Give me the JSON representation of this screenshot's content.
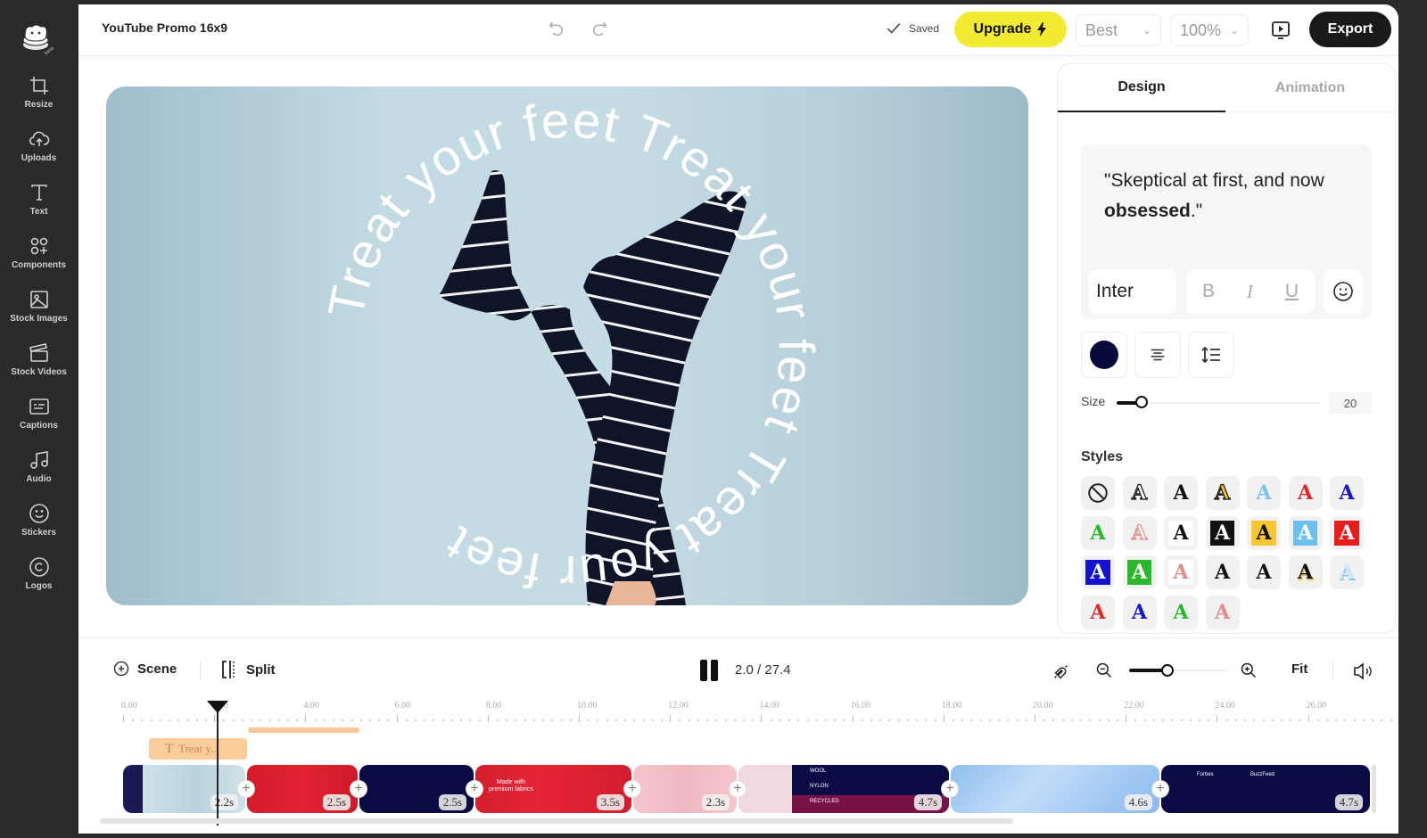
{
  "app": {
    "logo_badge": "beta",
    "project_title": "YouTube Promo 16x9"
  },
  "sidebar": {
    "items": [
      {
        "label": "Resize",
        "icon": "crop-icon"
      },
      {
        "label": "Uploads",
        "icon": "cloud-upload-icon"
      },
      {
        "label": "Text",
        "icon": "text-icon"
      },
      {
        "label": "Components",
        "icon": "components-icon"
      },
      {
        "label": "Stock Images",
        "icon": "image-icon"
      },
      {
        "label": "Stock Videos",
        "icon": "clapperboard-icon"
      },
      {
        "label": "Captions",
        "icon": "captions-icon"
      },
      {
        "label": "Audio",
        "icon": "music-note-icon"
      },
      {
        "label": "Stickers",
        "icon": "smiley-icon"
      },
      {
        "label": "Logos",
        "icon": "copyright-icon"
      }
    ]
  },
  "topbar": {
    "saved_label": "Saved",
    "upgrade_label": "Upgrade",
    "quality": "Best",
    "zoom": "100%",
    "export_label": "Export"
  },
  "canvas": {
    "circular_text": "Treat your feet Treat your feet Treat your feet",
    "colors": {
      "text": "#ffffff",
      "sock": "#101428",
      "stripe": "#f2f2f2"
    }
  },
  "panel": {
    "tabs": [
      {
        "label": "Design",
        "active": true
      },
      {
        "label": "Animation",
        "active": false
      }
    ],
    "text_preview_plain": "\"Skeptical at first, and now ",
    "text_preview_bold": "obsessed",
    "text_preview_end": ".\"",
    "font": "Inter",
    "format": {
      "bold": "B",
      "italic": "I",
      "underline": "U"
    },
    "text_color": "#0a0a3c",
    "size_label": "Size",
    "size_value": "20",
    "size_fraction": 0.09,
    "styles_title": "Styles",
    "style_count": 25
  },
  "timeline": {
    "scene_label": "Scene",
    "split_label": "Split",
    "time": "2.0 / 27.4",
    "fit_label": "Fit",
    "zoom_fraction": 0.38,
    "ruler": [
      "0.00",
      "2.00",
      "4.00",
      "6.00",
      "8.00",
      "10.00",
      "12.00",
      "14.00",
      "16.00",
      "18.00",
      "20.00",
      "22.00",
      "24.00",
      "26.00"
    ],
    "text_clip_label": "Treat y...",
    "clips": [
      {
        "duration": "2.2s",
        "theme": "intro"
      },
      {
        "duration": "2.5s",
        "theme": "red-socks"
      },
      {
        "duration": "2.5s",
        "theme": "navy"
      },
      {
        "duration": "3.5s",
        "theme": "premium-fabrics",
        "caption": "Made with premium fabrics"
      },
      {
        "duration": "2.3s",
        "theme": "pink"
      },
      {
        "duration": "4.7s",
        "theme": "materials",
        "tags": [
          "WOOL",
          "NYLON",
          "RECYCLED"
        ]
      },
      {
        "duration": "4.6s",
        "theme": "sky"
      },
      {
        "duration": "4.7s",
        "theme": "press",
        "tags": [
          "Forbes",
          "BuzzFeed"
        ]
      }
    ]
  }
}
